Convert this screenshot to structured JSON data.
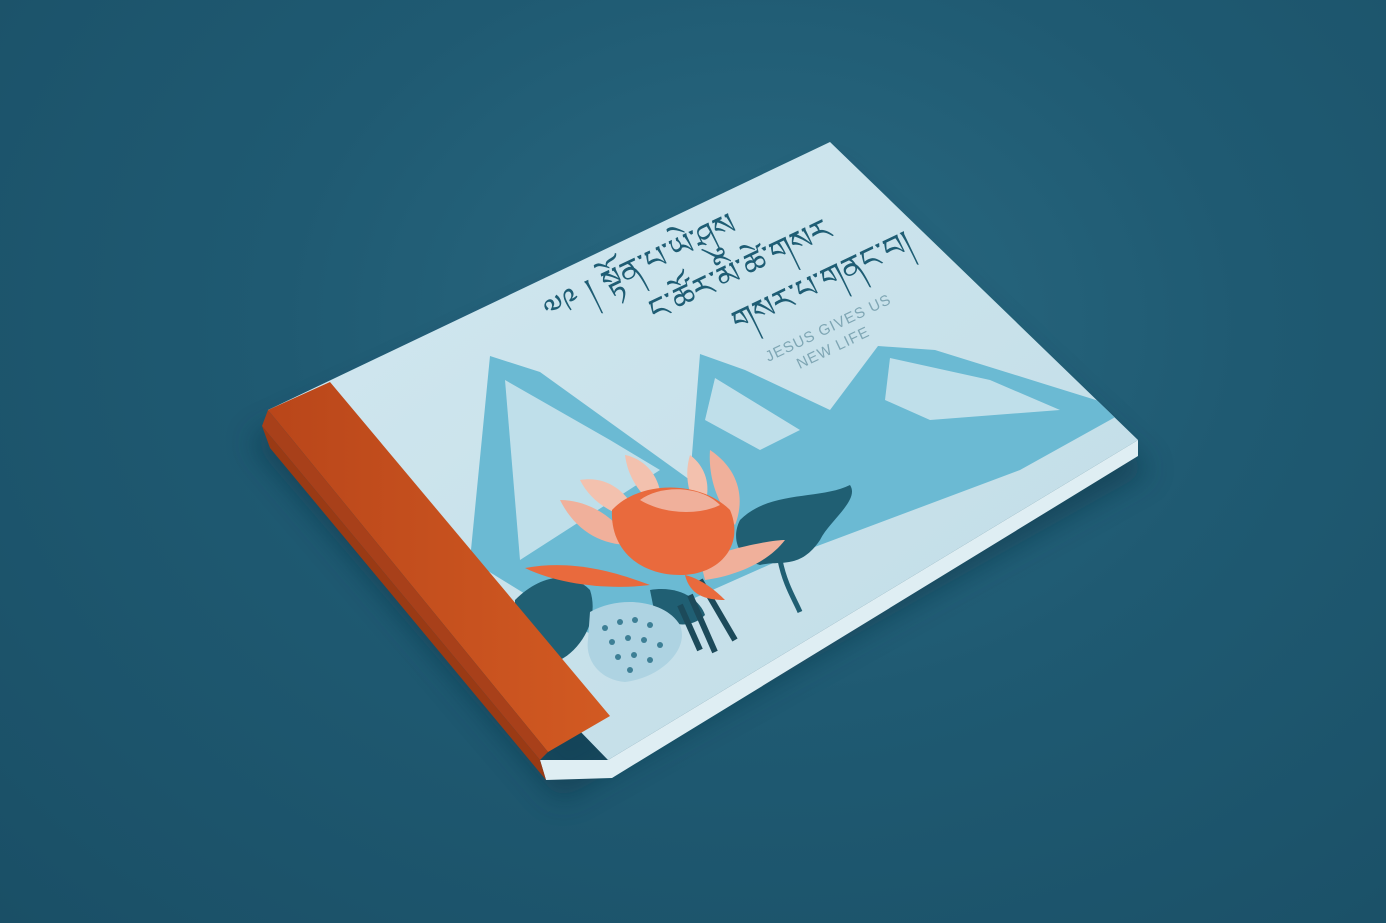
{
  "cover": {
    "tibetan_line_1": "༧༩ ། སྟོན་པ་ཡེ་ཤུས",
    "tibetan_line_2": "ང་ཚོར་མི་ཚེ་གསར",
    "tibetan_line_3": "གསར་པ་གནང་བ།",
    "english_line_1": "JESUS GIVES US",
    "english_line_2": "NEW LIFE"
  },
  "colors": {
    "background": "#1f5a72",
    "cover": "#c9e3ec",
    "spine": "#c8521e",
    "mountains": "#6bbad3",
    "lotus_petal": "#e96a3d",
    "lotus_light": "#f0b09b",
    "leaf": "#205f73"
  },
  "icons": [
    "lotus-flower-icon",
    "lotus-seed-pod-icon",
    "mountain-range-icon",
    "leaf-icon"
  ]
}
